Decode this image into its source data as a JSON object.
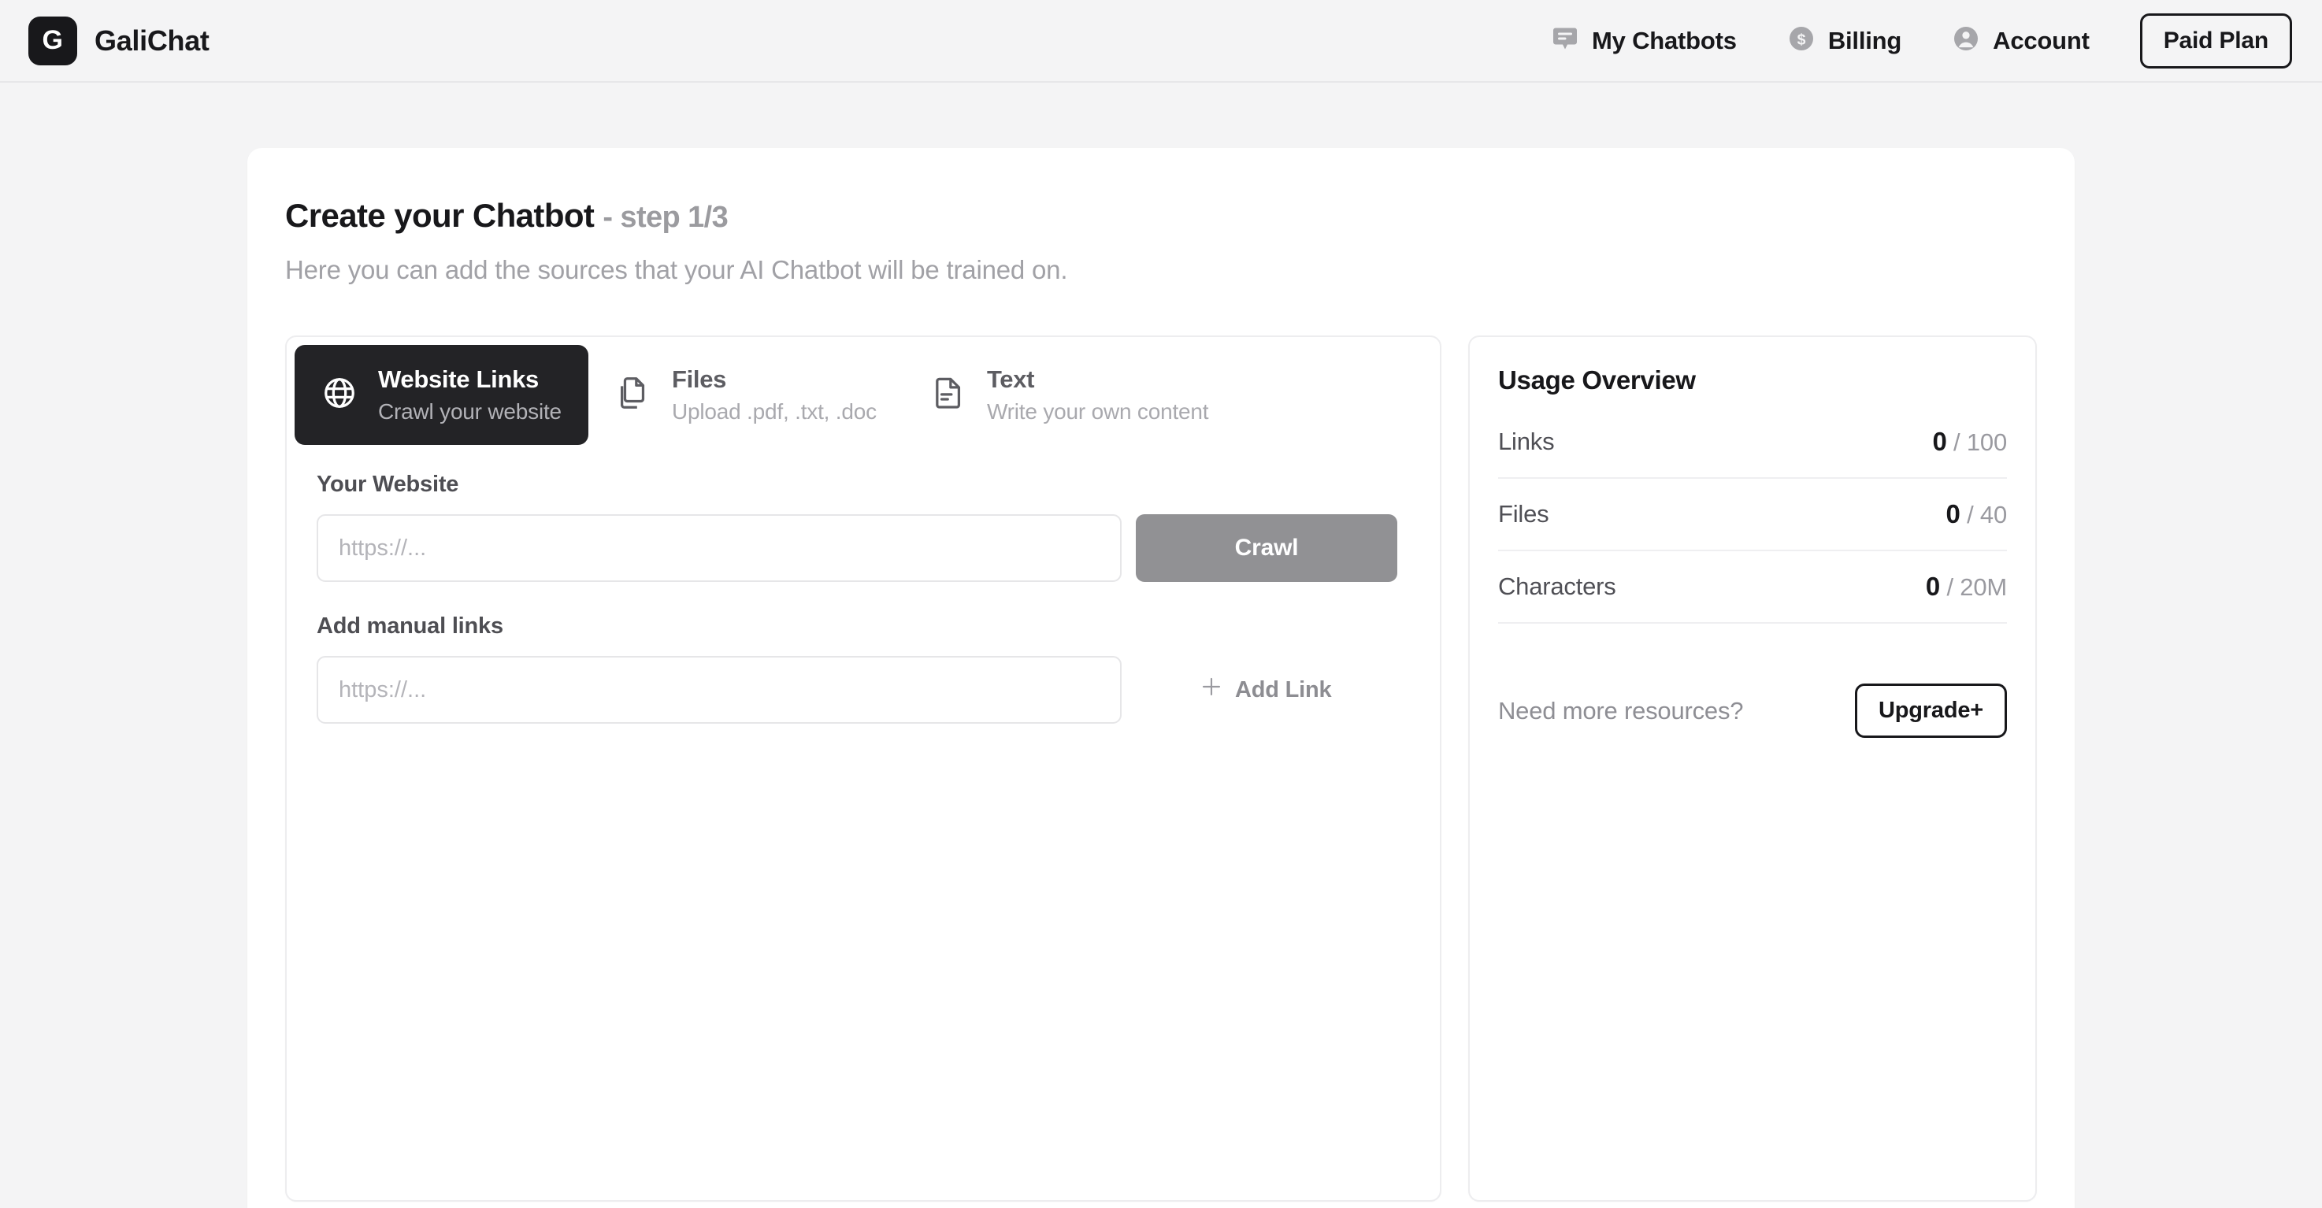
{
  "header": {
    "logo_letter": "G",
    "brand_name": "GaliChat",
    "nav": [
      {
        "label": "My Chatbots",
        "icon": "chat-bubble-icon"
      },
      {
        "label": "Billing",
        "icon": "dollar-circle-icon"
      },
      {
        "label": "Account",
        "icon": "user-circle-icon"
      }
    ],
    "plan_button": "Paid Plan"
  },
  "main": {
    "title": "Create your Chatbot",
    "step": "- step 1/3",
    "subtitle": "Here you can add the sources that your AI Chatbot will be trained on."
  },
  "tabs": [
    {
      "title": "Website Links",
      "subtitle": "Crawl your website",
      "icon": "globe-icon",
      "active": true
    },
    {
      "title": "Files",
      "subtitle": "Upload .pdf, .txt, .doc",
      "icon": "copy-documents-icon",
      "active": false
    },
    {
      "title": "Text",
      "subtitle": "Write your own content",
      "icon": "document-lines-icon",
      "active": false
    }
  ],
  "form": {
    "website_label": "Your Website",
    "website_placeholder": "https://...",
    "website_value": "",
    "crawl_button": "Crawl",
    "manual_label": "Add manual links",
    "manual_placeholder": "https://...",
    "manual_value": "",
    "add_link_button": "Add Link"
  },
  "usage": {
    "title": "Usage Overview",
    "rows": [
      {
        "name": "Links",
        "used": "0",
        "limit": "/ 100"
      },
      {
        "name": "Files",
        "used": "0",
        "limit": "/ 40"
      },
      {
        "name": "Characters",
        "used": "0",
        "limit": "/ 20M"
      }
    ],
    "upgrade_text": "Need more resources?",
    "upgrade_button": "Upgrade+"
  },
  "colors": {
    "page_background": "#f4f4f5",
    "card_background": "#ffffff",
    "accent_dark": "#18181b",
    "active_tab": "#232326",
    "muted_text": "#a1a1a6",
    "disabled_button": "#919194",
    "border": "#ededef"
  }
}
